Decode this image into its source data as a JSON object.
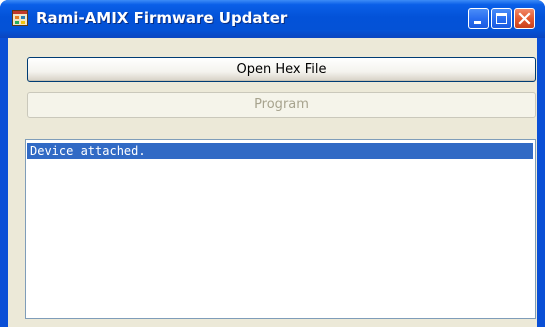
{
  "window": {
    "title": "Rami-AMIX Firmware Updater",
    "app_icon": "application-window-icon",
    "controls": [
      "minimize-icon",
      "maximize-icon",
      "close-icon"
    ]
  },
  "buttons": {
    "open_hex_label": "Open Hex File",
    "program_label": "Program",
    "program_enabled": false
  },
  "log": {
    "items": [
      "Device attached."
    ],
    "selected_index": 0
  },
  "colors": {
    "titlebar": "#0352d8",
    "client_background": "#ece9d8",
    "selection": "#316ac5",
    "disabled_text": "#a7a38e"
  }
}
